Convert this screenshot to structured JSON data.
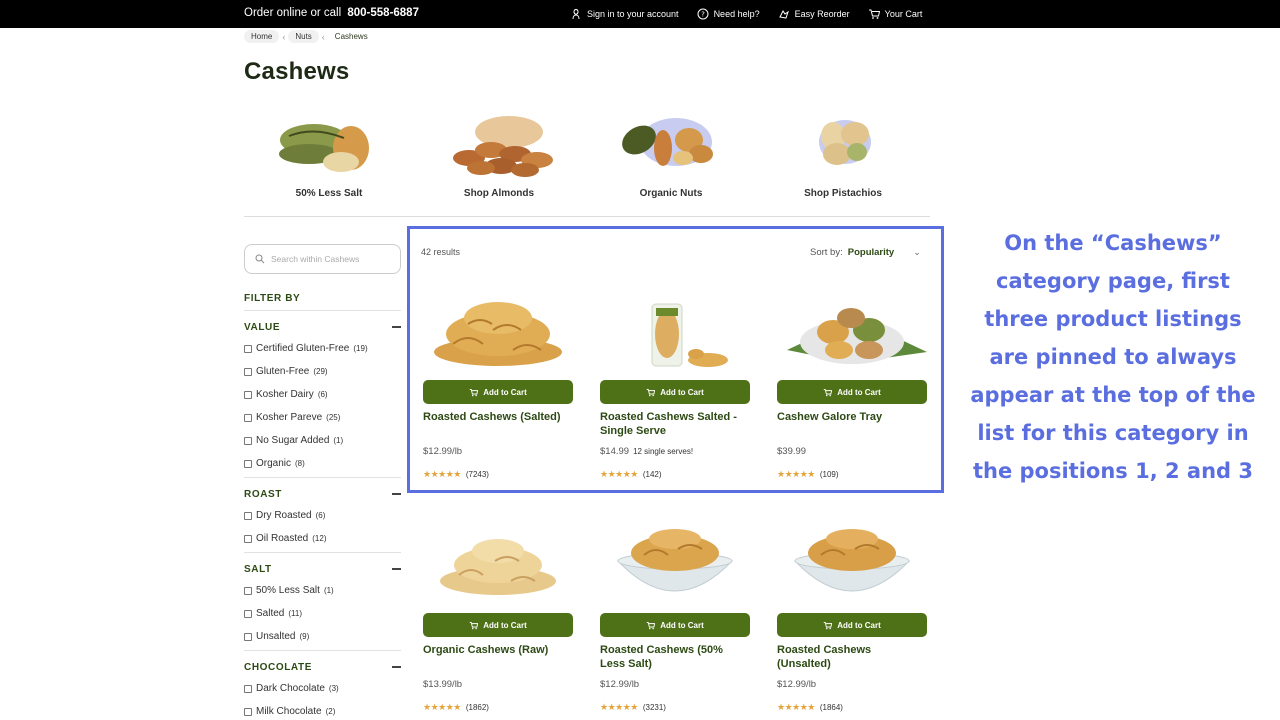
{
  "topbar": {
    "order_text": "Order online or call",
    "phone": "800-558-6887",
    "nav": [
      {
        "label": "Sign in to your account",
        "icon": "user-icon"
      },
      {
        "label": "Need help?",
        "icon": "help-icon"
      },
      {
        "label": "Easy Reorder",
        "icon": "reorder-icon"
      },
      {
        "label": "Your Cart",
        "icon": "cart-icon"
      }
    ]
  },
  "breadcrumb": [
    "Home",
    "Nuts",
    "Cashews"
  ],
  "page_title": "Cashews",
  "categories": [
    {
      "label": "50% Less Salt"
    },
    {
      "label": "Shop Almonds"
    },
    {
      "label": "Organic Nuts"
    },
    {
      "label": "Shop Pistachios"
    }
  ],
  "search": {
    "placeholder": "Search within Cashews"
  },
  "filter_title": "FILTER BY",
  "filters": [
    {
      "title": "VALUE",
      "options": [
        {
          "label": "Certified Gluten-Free",
          "count": "(19)"
        },
        {
          "label": "Gluten-Free",
          "count": "(29)"
        },
        {
          "label": "Kosher Dairy",
          "count": "(6)"
        },
        {
          "label": "Kosher Pareve",
          "count": "(25)"
        },
        {
          "label": "No Sugar Added",
          "count": "(1)"
        },
        {
          "label": "Organic",
          "count": "(8)"
        }
      ]
    },
    {
      "title": "ROAST",
      "options": [
        {
          "label": "Dry Roasted",
          "count": "(6)"
        },
        {
          "label": "Oil Roasted",
          "count": "(12)"
        }
      ]
    },
    {
      "title": "SALT",
      "options": [
        {
          "label": "50% Less Salt",
          "count": "(1)"
        },
        {
          "label": "Salted",
          "count": "(11)"
        },
        {
          "label": "Unsalted",
          "count": "(9)"
        }
      ]
    },
    {
      "title": "CHOCOLATE",
      "options": [
        {
          "label": "Dark Chocolate",
          "count": "(3)"
        },
        {
          "label": "Milk Chocolate",
          "count": "(2)"
        }
      ]
    }
  ],
  "results": {
    "count": "42 results",
    "sort_label": "Sort by:",
    "sort_value": "Popularity"
  },
  "add_to_cart": "Add to Cart",
  "stars": "★★★★★",
  "products": [
    {
      "name": "Roasted Cashews (Salted)",
      "price": "$12.99/lb",
      "note": "",
      "reviews": "(7243)"
    },
    {
      "name": "Roasted Cashews Salted - Single Serve",
      "price": "$14.99",
      "note": "12 single serves!",
      "reviews": "(142)"
    },
    {
      "name": "Cashew Galore Tray",
      "price": "$39.99",
      "note": "",
      "reviews": "(109)"
    },
    {
      "name": "Organic Cashews (Raw)",
      "price": "$13.99/lb",
      "note": "",
      "reviews": "(1862)"
    },
    {
      "name": "Roasted Cashews (50% Less Salt)",
      "price": "$12.99/lb",
      "note": "",
      "reviews": "(3231)"
    },
    {
      "name": "Roasted Cashews (Unsalted)",
      "price": "$12.99/lb",
      "note": "",
      "reviews": "(1864)"
    }
  ],
  "callout": "On the “Cashews” category page, first three product listings are pinned to always appear at the top of the list for this category in the positions 1, 2 and 3",
  "colors": {
    "accent": "#4e7017",
    "highlight": "#5a6ee0",
    "title": "#1e2a14"
  }
}
